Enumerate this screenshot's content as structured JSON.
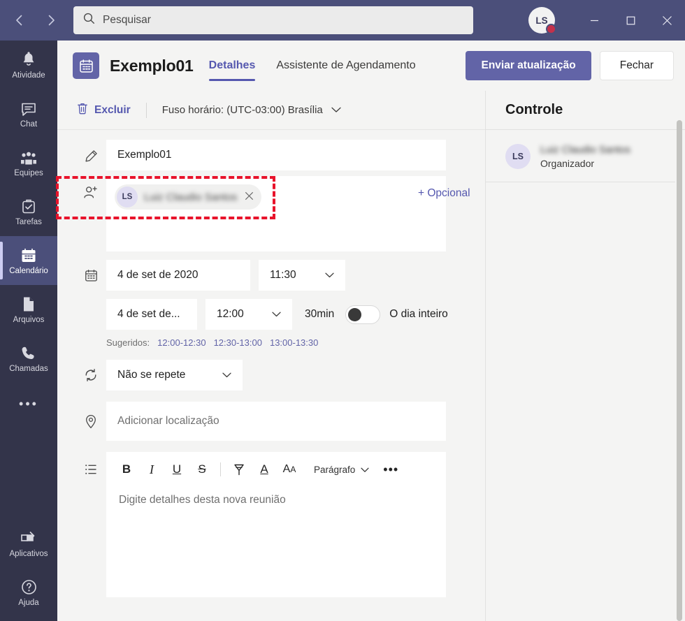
{
  "titlebar": {
    "back_icon": "chevron-left-icon",
    "forward_icon": "chevron-right-icon",
    "search_placeholder": "Pesquisar",
    "avatar_initials": "LS",
    "presence_color": "#c4314b",
    "minimize_label": "—",
    "maximize_label": "☐",
    "close_label": "×",
    "background": "#4b4f7a"
  },
  "rail": {
    "items": [
      {
        "label": "Atividade",
        "icon": "bell-icon",
        "active": false
      },
      {
        "label": "Chat",
        "icon": "chat-icon",
        "active": false
      },
      {
        "label": "Equipes",
        "icon": "teams-icon",
        "active": false
      },
      {
        "label": "Tarefas",
        "icon": "tasks-icon",
        "active": false
      },
      {
        "label": "Calendário",
        "icon": "calendar-icon",
        "active": true
      },
      {
        "label": "Arquivos",
        "icon": "files-icon",
        "active": false
      },
      {
        "label": "Chamadas",
        "icon": "phone-icon",
        "active": false
      }
    ],
    "more_label": "•••",
    "bottom_items": [
      {
        "label": "Aplicativos",
        "icon": "apps-icon"
      },
      {
        "label": "Ajuda",
        "icon": "help-icon"
      }
    ]
  },
  "header": {
    "icon": "calendar-event-icon",
    "title": "Exemplo01",
    "tabs": [
      {
        "label": "Detalhes",
        "active": true
      },
      {
        "label": "Assistente de Agendamento",
        "active": false
      }
    ],
    "primary_button": "Enviar atualização",
    "secondary_button": "Fechar",
    "accent_color": "#6264a7"
  },
  "toolbar": {
    "delete_label": "Excluir",
    "delete_icon": "trash-icon",
    "timezone_label": "Fuso horário: (UTC-03:00) Brasília",
    "chevron_icon": "chevron-down-icon"
  },
  "form": {
    "title_icon": "pencil-icon",
    "title_value": "Exemplo01",
    "attendees_icon": "add-person-icon",
    "attendee": {
      "initials": "LS",
      "name": "Luiz Claudio Santos",
      "remove_icon": "close-icon"
    },
    "optional_label": "+ Opcional",
    "date_icon": "calendar-icon",
    "start_date": "4 de set de 2020",
    "start_time": "11:30",
    "end_date": "4 de set de...",
    "end_time": "12:00",
    "duration": "30min",
    "allday_label": "O dia inteiro",
    "allday_on": false,
    "suggested_label": "Sugeridos:",
    "suggested_times": [
      "12:00-12:30",
      "12:30-13:00",
      "13:00-13:30"
    ],
    "repeat_icon": "repeat-icon",
    "repeat_value": "Não se repete",
    "location_icon": "location-pin-icon",
    "location_placeholder": "Adicionar localização",
    "body_icon": "list-icon",
    "body_placeholder": "Digite detalhes desta nova reunião",
    "editor_tools": [
      {
        "name": "bold",
        "glyph": "B"
      },
      {
        "name": "italic",
        "glyph": "I"
      },
      {
        "name": "underline",
        "glyph": "U"
      },
      {
        "name": "strikethrough",
        "glyph": "S"
      },
      {
        "name": "highlight",
        "glyph": "⧫"
      },
      {
        "name": "font-color",
        "glyph": "A"
      },
      {
        "name": "font-size",
        "glyph": "Aᴀ"
      }
    ],
    "paragraph_label": "Parágrafo",
    "more_label": "•••",
    "annotation_color": "#e8132b"
  },
  "right_panel": {
    "title": "Controle",
    "person": {
      "initials": "LS",
      "name": "Luiz Claudio Santos",
      "role": "Organizador"
    }
  }
}
